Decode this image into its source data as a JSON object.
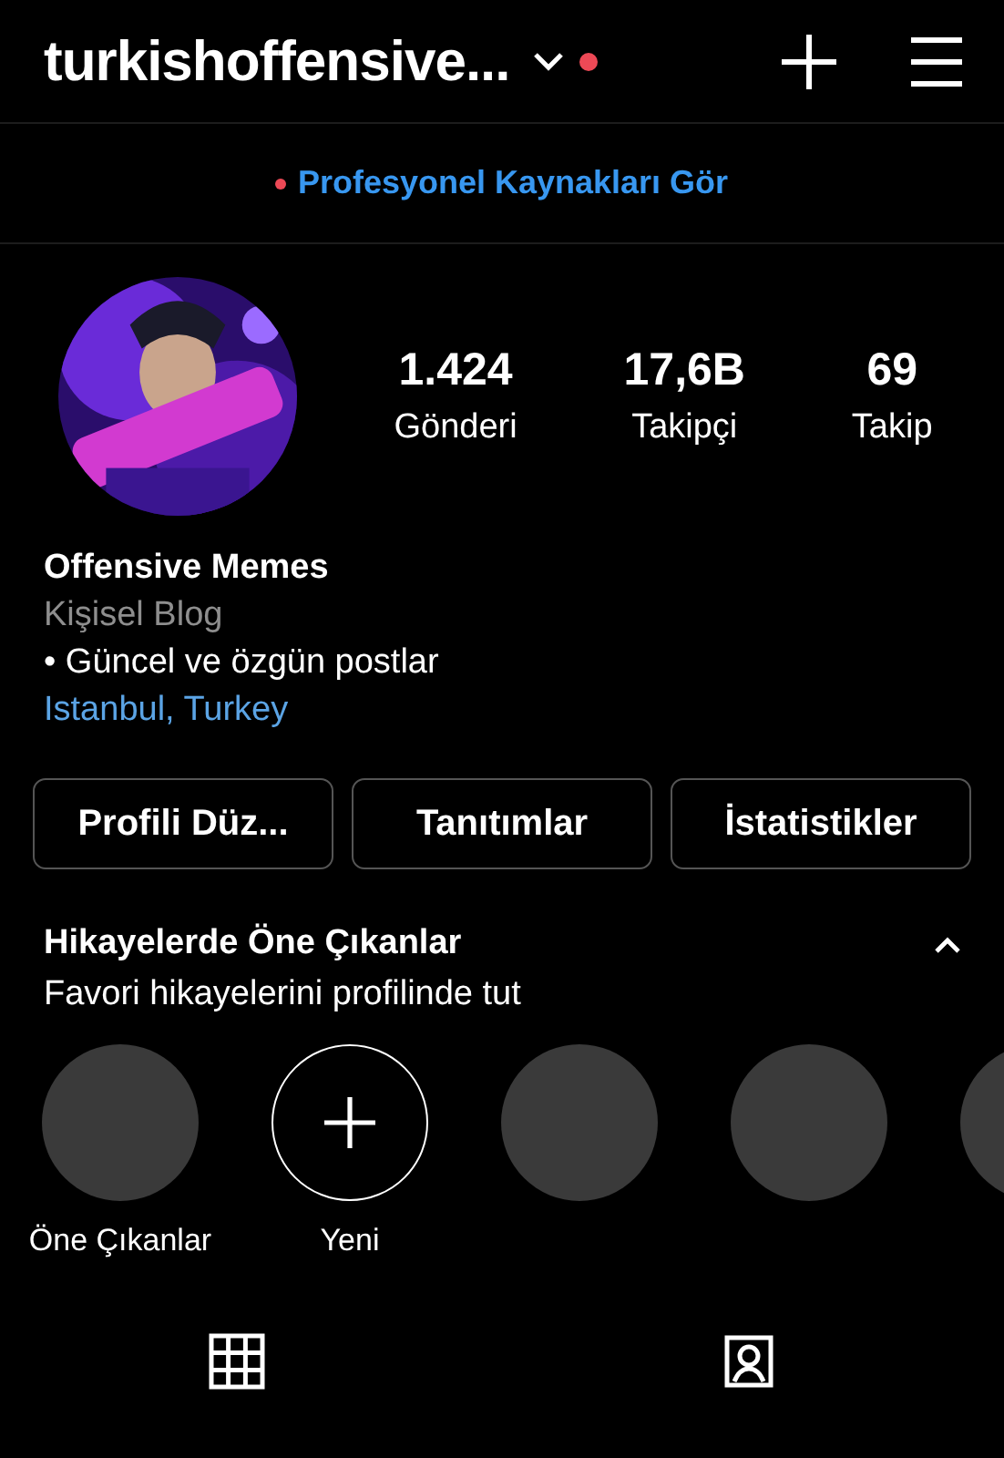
{
  "header": {
    "username": "turkishoffensive...",
    "notification_dot": true
  },
  "pro_banner": {
    "text": "Profesyonel Kaynakları Gör"
  },
  "profile": {
    "stats": [
      {
        "value": "1.424",
        "label": "Gönderi"
      },
      {
        "value": "17,6B",
        "label": "Takipçi"
      },
      {
        "value": "69",
        "label": "Takip"
      }
    ],
    "name": "Offensive Memes",
    "category": "Kişisel Blog",
    "bio": "• Güncel ve özgün postlar",
    "location": "Istanbul, Turkey"
  },
  "buttons": [
    "Profili Düz...",
    "Tanıtımlar",
    "İstatistikler"
  ],
  "highlights": {
    "title": "Hikayelerde Öne Çıkanlar",
    "subtitle": "Favori hikayelerini profilinde tut",
    "expanded": true,
    "items": [
      {
        "kind": "empty",
        "label": "Öne Çıkanlar"
      },
      {
        "kind": "new",
        "label": "Yeni"
      },
      {
        "kind": "empty"
      },
      {
        "kind": "empty"
      },
      {
        "kind": "empty"
      }
    ]
  },
  "tabs": [
    {
      "kind": "grid"
    },
    {
      "kind": "tagged"
    }
  ]
}
